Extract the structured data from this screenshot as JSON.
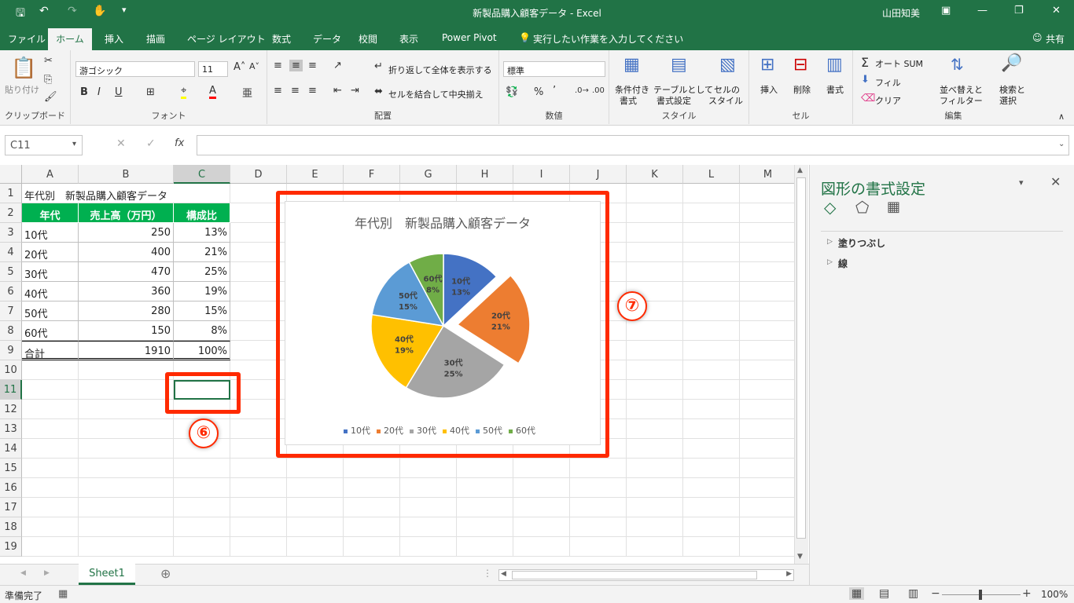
{
  "titlebar": {
    "title": "新製品購入顧客データ  -  Excel",
    "user": "山田知美"
  },
  "tabs": [
    "ファイル",
    "ホーム",
    "挿入",
    "描画",
    "ページ レイアウト",
    "数式",
    "データ",
    "校閲",
    "表示",
    "Power Pivot",
    "実行したい作業を入力してください"
  ],
  "share": "共有",
  "ribbon": {
    "clipboard": {
      "paste": "貼り付け",
      "label": "クリップボード"
    },
    "font": {
      "name": "游ゴシック",
      "size": "11",
      "label": "フォント",
      "bold": "B",
      "italic": "I",
      "underline": "U"
    },
    "align": {
      "wrap": "折り返して全体を表示する",
      "merge": "セルを結合して中央揃え",
      "label": "配置"
    },
    "number": {
      "format": "標準",
      "label": "数値"
    },
    "styles": {
      "cond1": "条件付き",
      "cond2": "書式",
      "table1": "テーブルとして",
      "table2": "書式設定",
      "cell1": "セルの",
      "cell2": "スタイル",
      "label": "スタイル"
    },
    "cells": {
      "insert": "挿入",
      "delete": "削除",
      "format": "書式",
      "label": "セル"
    },
    "edit": {
      "autosum": "オート SUM",
      "fill": "フィル",
      "clear": "クリア",
      "sort1": "並べ替えと",
      "sort2": "フィルター",
      "find1": "検索と",
      "find2": "選択",
      "label": "編集"
    }
  },
  "formula": {
    "namebox": "C11",
    "fx": "fx",
    "value": ""
  },
  "columns": [
    "A",
    "B",
    "C",
    "D",
    "E",
    "F",
    "G",
    "H",
    "I",
    "J",
    "K",
    "L",
    "M"
  ],
  "rows": [
    "1",
    "2",
    "3",
    "4",
    "5",
    "6",
    "7",
    "8",
    "9",
    "10",
    "11",
    "12",
    "13",
    "14",
    "15",
    "16",
    "17",
    "18",
    "19"
  ],
  "table": {
    "title": "年代別　新製品購入顧客データ",
    "headers": [
      "年代",
      "売上高（万円）",
      "構成比"
    ],
    "data": [
      [
        "10代",
        "250",
        "13%"
      ],
      [
        "20代",
        "400",
        "21%"
      ],
      [
        "30代",
        "470",
        "25%"
      ],
      [
        "40代",
        "360",
        "19%"
      ],
      [
        "50代",
        "280",
        "15%"
      ],
      [
        "60代",
        "150",
        "8%"
      ]
    ],
    "total": [
      "合計",
      "1910",
      "100%"
    ]
  },
  "chart_data": {
    "type": "pie",
    "title": "年代別　新製品購入顧客データ",
    "categories": [
      "10代",
      "20代",
      "30代",
      "40代",
      "50代",
      "60代"
    ],
    "values": [
      250,
      400,
      470,
      360,
      280,
      150
    ],
    "percent_labels": [
      "13%",
      "21%",
      "25%",
      "19%",
      "15%",
      "8%"
    ],
    "colors": [
      "#4472c4",
      "#ed7d31",
      "#a5a5a5",
      "#ffc000",
      "#5b9bd5",
      "#70ad47"
    ],
    "exploded": "20代",
    "legend": "bottom"
  },
  "annotations": {
    "six": "⑥",
    "seven": "⑦"
  },
  "pane": {
    "title": "図形の書式設定",
    "items": [
      "塗りつぶし",
      "線"
    ]
  },
  "sheet": {
    "tab": "Sheet1"
  },
  "status": {
    "ready": "準備完了",
    "zoom": "100%"
  }
}
